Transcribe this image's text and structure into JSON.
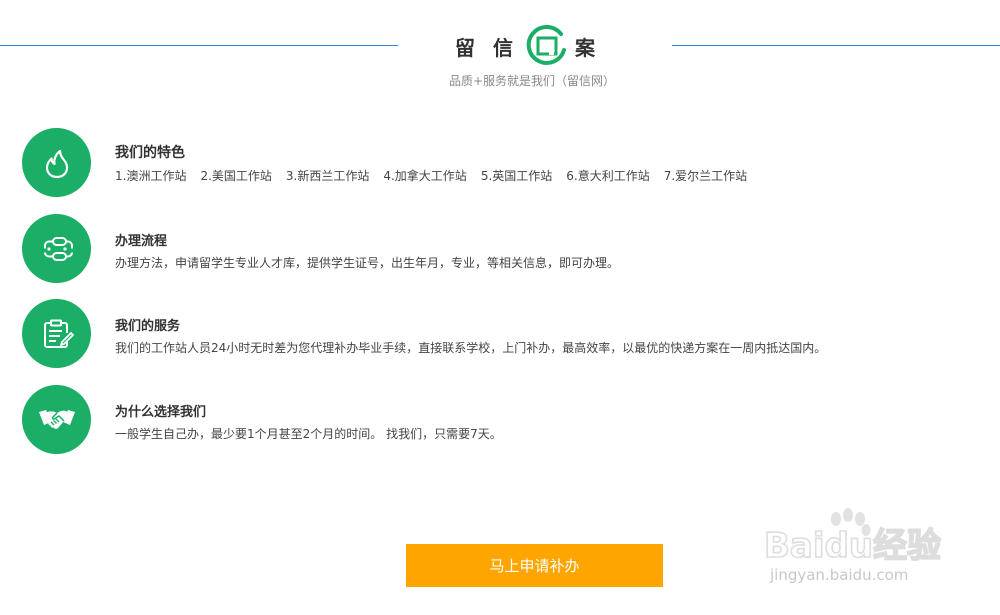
{
  "header": {
    "logo_chars": [
      "留",
      "信",
      "案"
    ],
    "tagline": "品质+服务就是我们（留信网）"
  },
  "features": [
    {
      "icon": "flame-icon",
      "title": "我们的特色",
      "stations": [
        "1.澳洲工作站",
        "2.美国工作站",
        "3.新西兰工作站",
        "4.加拿大工作站",
        "5.英国工作站",
        "6.意大利工作站",
        "7.爱尔兰工作站"
      ]
    },
    {
      "icon": "process-flow-icon",
      "title": "办理流程",
      "desc": "办理方法，申请留学生专业人才库，提供学生证号，出生年月，专业，等相关信息，即可办理。"
    },
    {
      "icon": "clipboard-pen-icon",
      "title": "我们的服务",
      "desc": "我们的工作站人员24小时无时差为您代理补办毕业手续，直接联系学校，上门补办，最高效率，以最优的快递方案在一周内抵达国内。"
    },
    {
      "icon": "handshake-icon",
      "title": "为什么选择我们",
      "desc": "一般学生自己办，最少要1个月甚至2个月的时间。 找我们，只需要7天。"
    }
  ],
  "cta": {
    "label": "马上申请补办"
  },
  "watermark": {
    "brand": "Baidu经验",
    "url": "jingyan.baidu.com"
  },
  "colors": {
    "accent_green": "#1aae66",
    "cta_orange": "#ffa500",
    "header_line_blue": "#2a86d6"
  }
}
